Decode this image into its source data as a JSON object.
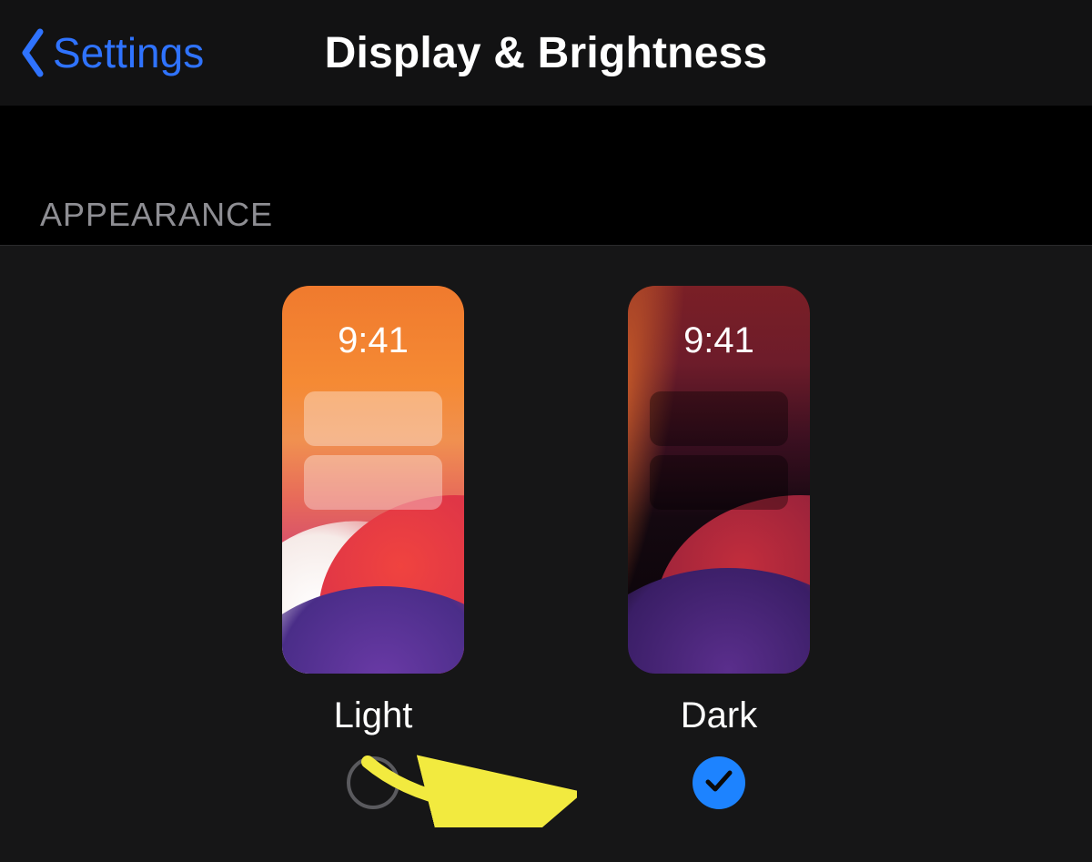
{
  "nav": {
    "back_label": "Settings",
    "title": "Display & Brightness"
  },
  "section": {
    "header": "APPEARANCE"
  },
  "appearance": {
    "preview_time": "9:41",
    "options": [
      {
        "label": "Light",
        "selected": false
      },
      {
        "label": "Dark",
        "selected": true
      }
    ]
  },
  "colors": {
    "tint": "#2f73ff",
    "accent_blue": "#1d83ff",
    "muted": "#8e8e93"
  }
}
